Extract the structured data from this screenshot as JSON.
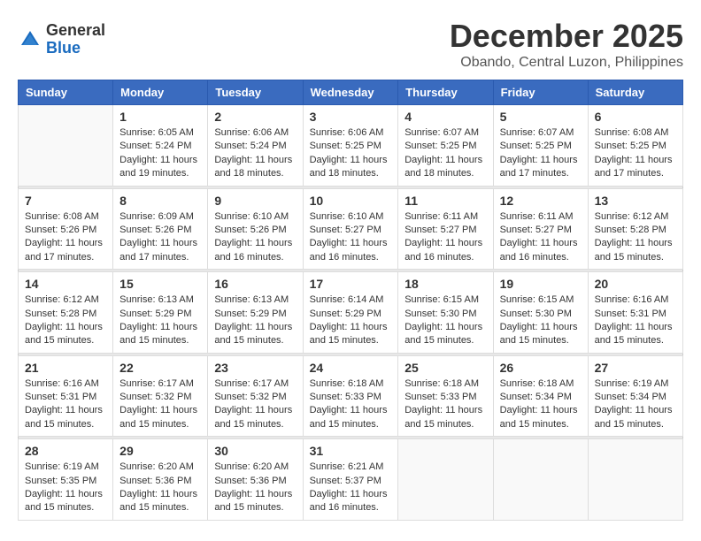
{
  "logo": {
    "general": "General",
    "blue": "Blue"
  },
  "title": "December 2025",
  "location": "Obando, Central Luzon, Philippines",
  "weekdays": [
    "Sunday",
    "Monday",
    "Tuesday",
    "Wednesday",
    "Thursday",
    "Friday",
    "Saturday"
  ],
  "weeks": [
    [
      {
        "day": "",
        "info": ""
      },
      {
        "day": "1",
        "info": "Sunrise: 6:05 AM\nSunset: 5:24 PM\nDaylight: 11 hours\nand 19 minutes."
      },
      {
        "day": "2",
        "info": "Sunrise: 6:06 AM\nSunset: 5:24 PM\nDaylight: 11 hours\nand 18 minutes."
      },
      {
        "day": "3",
        "info": "Sunrise: 6:06 AM\nSunset: 5:25 PM\nDaylight: 11 hours\nand 18 minutes."
      },
      {
        "day": "4",
        "info": "Sunrise: 6:07 AM\nSunset: 5:25 PM\nDaylight: 11 hours\nand 18 minutes."
      },
      {
        "day": "5",
        "info": "Sunrise: 6:07 AM\nSunset: 5:25 PM\nDaylight: 11 hours\nand 17 minutes."
      },
      {
        "day": "6",
        "info": "Sunrise: 6:08 AM\nSunset: 5:25 PM\nDaylight: 11 hours\nand 17 minutes."
      }
    ],
    [
      {
        "day": "7",
        "info": "Sunrise: 6:08 AM\nSunset: 5:26 PM\nDaylight: 11 hours\nand 17 minutes."
      },
      {
        "day": "8",
        "info": "Sunrise: 6:09 AM\nSunset: 5:26 PM\nDaylight: 11 hours\nand 17 minutes."
      },
      {
        "day": "9",
        "info": "Sunrise: 6:10 AM\nSunset: 5:26 PM\nDaylight: 11 hours\nand 16 minutes."
      },
      {
        "day": "10",
        "info": "Sunrise: 6:10 AM\nSunset: 5:27 PM\nDaylight: 11 hours\nand 16 minutes."
      },
      {
        "day": "11",
        "info": "Sunrise: 6:11 AM\nSunset: 5:27 PM\nDaylight: 11 hours\nand 16 minutes."
      },
      {
        "day": "12",
        "info": "Sunrise: 6:11 AM\nSunset: 5:27 PM\nDaylight: 11 hours\nand 16 minutes."
      },
      {
        "day": "13",
        "info": "Sunrise: 6:12 AM\nSunset: 5:28 PM\nDaylight: 11 hours\nand 15 minutes."
      }
    ],
    [
      {
        "day": "14",
        "info": "Sunrise: 6:12 AM\nSunset: 5:28 PM\nDaylight: 11 hours\nand 15 minutes."
      },
      {
        "day": "15",
        "info": "Sunrise: 6:13 AM\nSunset: 5:29 PM\nDaylight: 11 hours\nand 15 minutes."
      },
      {
        "day": "16",
        "info": "Sunrise: 6:13 AM\nSunset: 5:29 PM\nDaylight: 11 hours\nand 15 minutes."
      },
      {
        "day": "17",
        "info": "Sunrise: 6:14 AM\nSunset: 5:29 PM\nDaylight: 11 hours\nand 15 minutes."
      },
      {
        "day": "18",
        "info": "Sunrise: 6:15 AM\nSunset: 5:30 PM\nDaylight: 11 hours\nand 15 minutes."
      },
      {
        "day": "19",
        "info": "Sunrise: 6:15 AM\nSunset: 5:30 PM\nDaylight: 11 hours\nand 15 minutes."
      },
      {
        "day": "20",
        "info": "Sunrise: 6:16 AM\nSunset: 5:31 PM\nDaylight: 11 hours\nand 15 minutes."
      }
    ],
    [
      {
        "day": "21",
        "info": "Sunrise: 6:16 AM\nSunset: 5:31 PM\nDaylight: 11 hours\nand 15 minutes."
      },
      {
        "day": "22",
        "info": "Sunrise: 6:17 AM\nSunset: 5:32 PM\nDaylight: 11 hours\nand 15 minutes."
      },
      {
        "day": "23",
        "info": "Sunrise: 6:17 AM\nSunset: 5:32 PM\nDaylight: 11 hours\nand 15 minutes."
      },
      {
        "day": "24",
        "info": "Sunrise: 6:18 AM\nSunset: 5:33 PM\nDaylight: 11 hours\nand 15 minutes."
      },
      {
        "day": "25",
        "info": "Sunrise: 6:18 AM\nSunset: 5:33 PM\nDaylight: 11 hours\nand 15 minutes."
      },
      {
        "day": "26",
        "info": "Sunrise: 6:18 AM\nSunset: 5:34 PM\nDaylight: 11 hours\nand 15 minutes."
      },
      {
        "day": "27",
        "info": "Sunrise: 6:19 AM\nSunset: 5:34 PM\nDaylight: 11 hours\nand 15 minutes."
      }
    ],
    [
      {
        "day": "28",
        "info": "Sunrise: 6:19 AM\nSunset: 5:35 PM\nDaylight: 11 hours\nand 15 minutes."
      },
      {
        "day": "29",
        "info": "Sunrise: 6:20 AM\nSunset: 5:36 PM\nDaylight: 11 hours\nand 15 minutes."
      },
      {
        "day": "30",
        "info": "Sunrise: 6:20 AM\nSunset: 5:36 PM\nDaylight: 11 hours\nand 15 minutes."
      },
      {
        "day": "31",
        "info": "Sunrise: 6:21 AM\nSunset: 5:37 PM\nDaylight: 11 hours\nand 16 minutes."
      },
      {
        "day": "",
        "info": ""
      },
      {
        "day": "",
        "info": ""
      },
      {
        "day": "",
        "info": ""
      }
    ]
  ]
}
